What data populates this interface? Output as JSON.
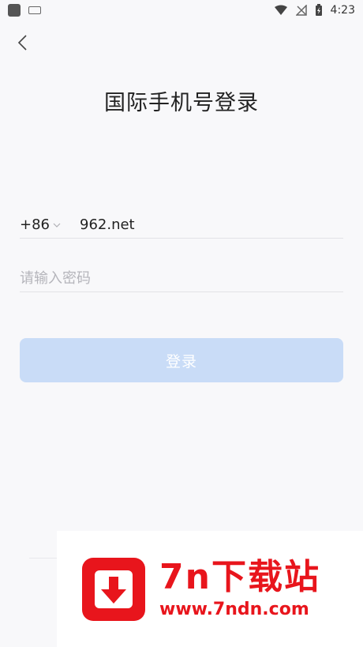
{
  "status_bar": {
    "time": "4:23"
  },
  "header": {
    "title": "国际手机号登录"
  },
  "form": {
    "country_code": "+86",
    "phone_value": "962.net",
    "password_placeholder": "请输入密码",
    "login_label": "登录"
  },
  "colors": {
    "accent_button": "#c9dcf7",
    "watermark_red": "#e8151c"
  },
  "watermark": {
    "brand": "7n下载站",
    "url": "www.7ndn.com"
  }
}
